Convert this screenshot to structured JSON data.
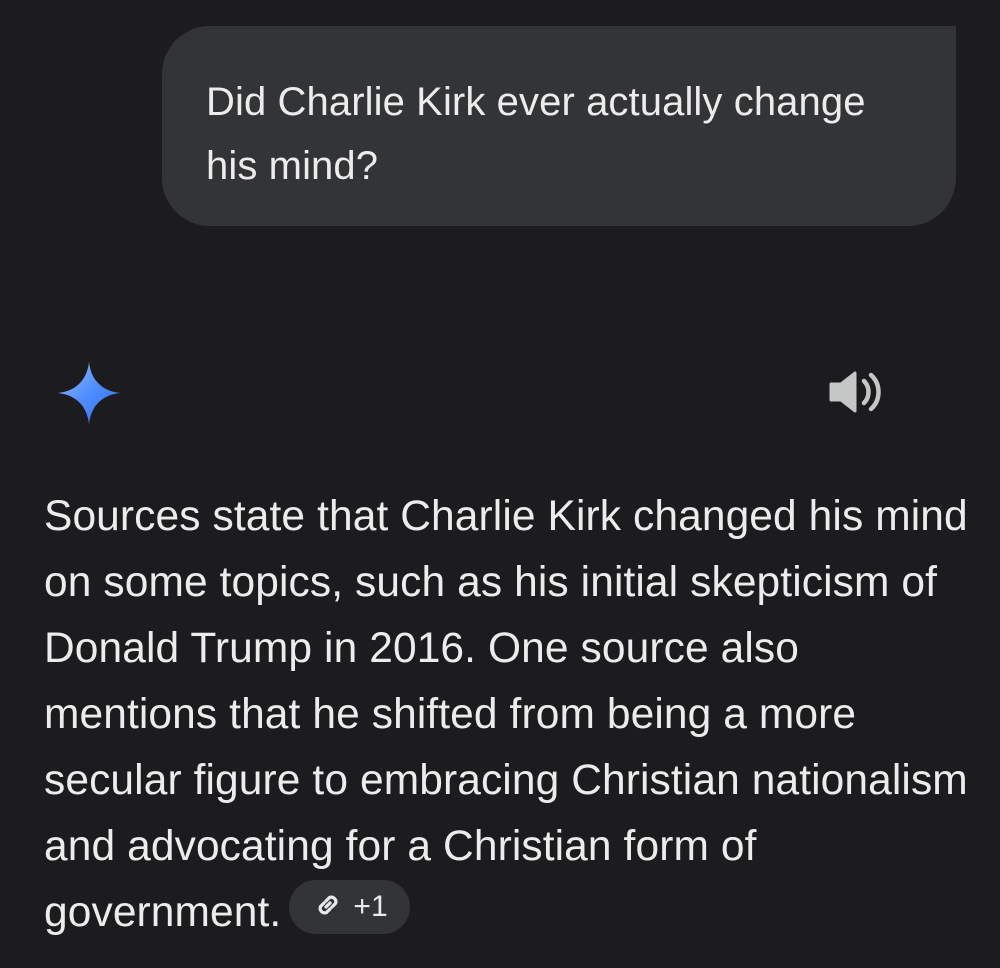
{
  "user_message": {
    "text": "Did Charlie Kirk ever actually change his mind?"
  },
  "assistant": {
    "icon": "gemini-sparkle-icon",
    "speaker_icon": "speaker-icon",
    "response_text": "Sources state that Charlie Kirk changed his mind on some topics, such as his initial skepticism of Donald Trump in 2016. One source also mentions that he shifted from being a more secular figure to embracing Christian nationalism and advocating for a Christian form of government.",
    "source_chip": {
      "icon": "link-icon",
      "count_label": "+1"
    }
  },
  "colors": {
    "background": "#1c1c1e",
    "bubble": "#333436",
    "text": "#ececed",
    "gem_light": "#8ab4f8",
    "gem_dark": "#3a7bff",
    "icon_gray": "#c4c7c5"
  }
}
